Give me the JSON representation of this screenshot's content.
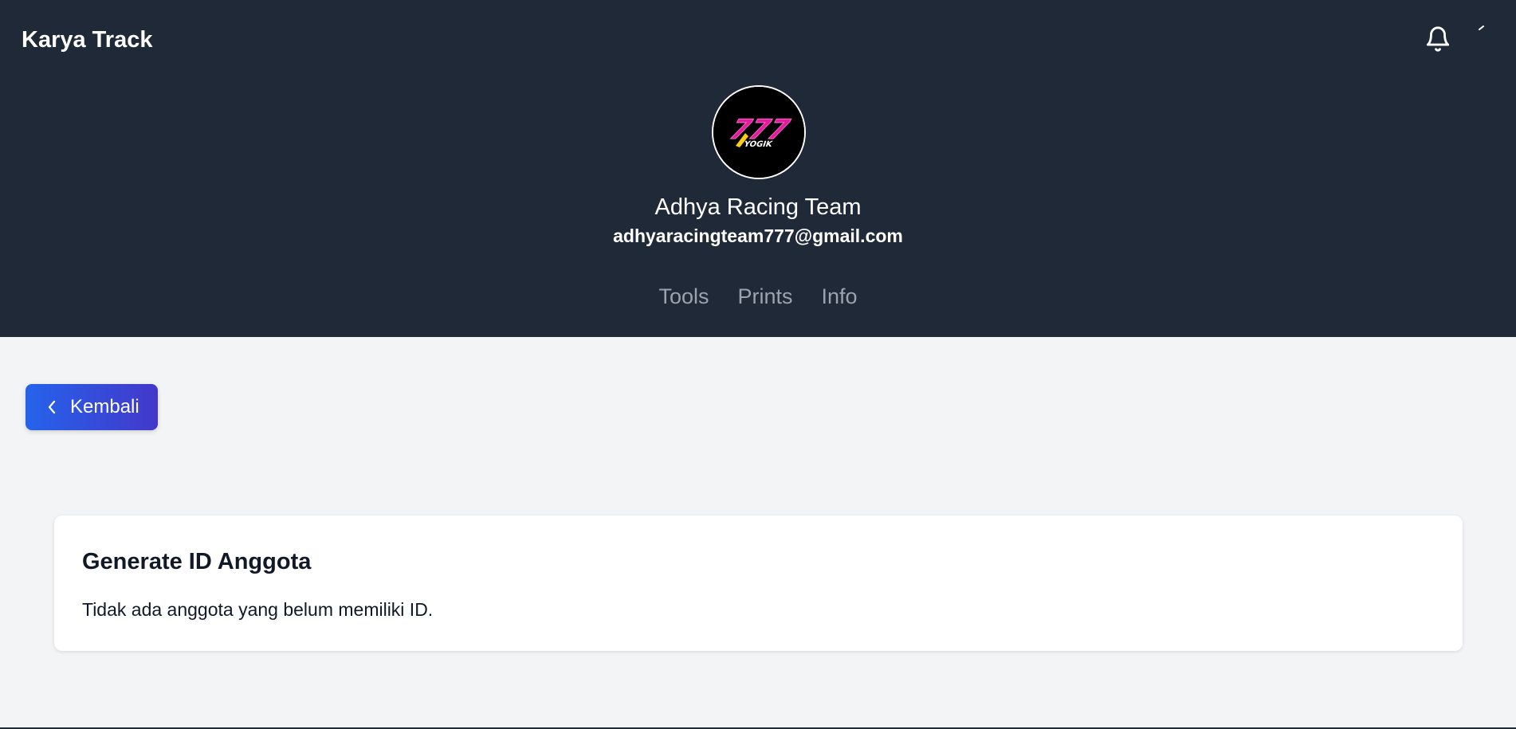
{
  "app": {
    "title": "Karya Track"
  },
  "header": {
    "notification_icon": "bell-icon",
    "team": {
      "name": "Adhya Racing Team",
      "email": "adhyaracingteam777@gmail.com",
      "logo_text": "777",
      "logo_subtext": "YOGIK"
    },
    "tabs": [
      {
        "label": "Tools"
      },
      {
        "label": "Prints"
      },
      {
        "label": "Info"
      }
    ]
  },
  "actions": {
    "back_label": "Kembali",
    "back_icon": "chevron-left-icon"
  },
  "card": {
    "title": "Generate ID Anggota",
    "message": "Tidak ada anggota yang belum memiliki ID."
  },
  "colors": {
    "header_bg": "#1f2937",
    "page_bg": "#f3f4f6",
    "accent_start": "#2563eb",
    "accent_end": "#4338ca",
    "tab_text": "#9ca3af"
  }
}
